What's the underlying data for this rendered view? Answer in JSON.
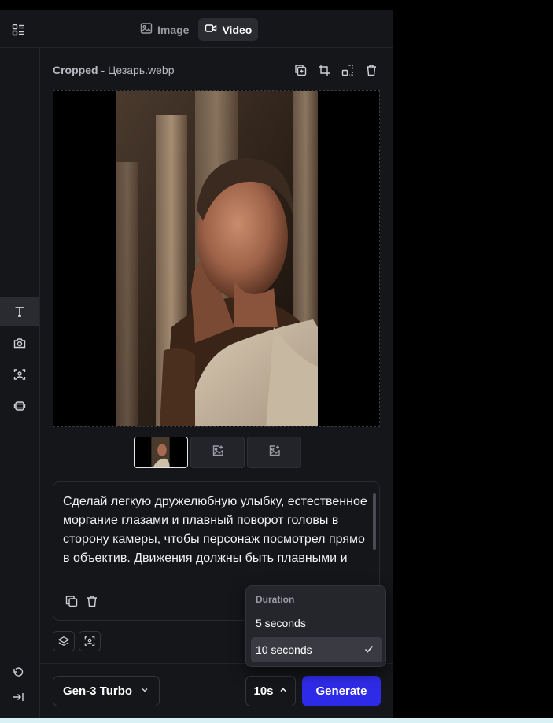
{
  "header": {
    "layout_icon": "layout-grid-icon",
    "modes": [
      {
        "label": "Image",
        "icon": "image-icon",
        "active": false
      },
      {
        "label": "Video",
        "icon": "video-camera-icon",
        "active": true
      }
    ]
  },
  "sidebar": {
    "items": [
      {
        "name": "text-tool",
        "icon": "text-T-icon",
        "active": true
      },
      {
        "name": "camera-tool",
        "icon": "camera-icon",
        "active": false
      },
      {
        "name": "face-scan-tool",
        "icon": "face-scan-icon",
        "active": false
      },
      {
        "name": "frames-tool",
        "icon": "frames-icon",
        "active": false
      }
    ],
    "bottom": [
      {
        "name": "undo",
        "icon": "undo-icon"
      },
      {
        "name": "collapse",
        "icon": "collapse-right-icon"
      }
    ]
  },
  "file": {
    "prefix": "Cropped",
    "separator": " - ",
    "name": "Цезарь.webp",
    "tools": [
      "duplicate-icon",
      "crop-icon",
      "expand-icon",
      "trash-icon"
    ]
  },
  "thumbnails": [
    {
      "type": "image",
      "selected": true
    },
    {
      "type": "add-image",
      "icon": "image-plus-icon"
    },
    {
      "type": "add-image",
      "icon": "image-plus-icon"
    }
  ],
  "prompt": {
    "text": "Сделай легкую дружелюбную улыбку, естественное моргание глазами и плавный поворот головы в сторону камеры, чтобы персонаж посмотрел прямо в объектив. Движения должны быть плавными и",
    "actions": [
      "copy-icon",
      "trash-icon"
    ]
  },
  "extra_buttons": [
    "layers-icon",
    "face-scan-icon"
  ],
  "duration_menu": {
    "title": "Duration",
    "options": [
      {
        "label": "5 seconds",
        "selected": false
      },
      {
        "label": "10 seconds",
        "selected": true
      }
    ]
  },
  "footer": {
    "model": "Gen-3 Turbo",
    "duration": "10s",
    "generate": "Generate"
  },
  "colors": {
    "panel": "#15161a",
    "accent": "#2e2be8",
    "active_bg": "#2b2c32"
  }
}
